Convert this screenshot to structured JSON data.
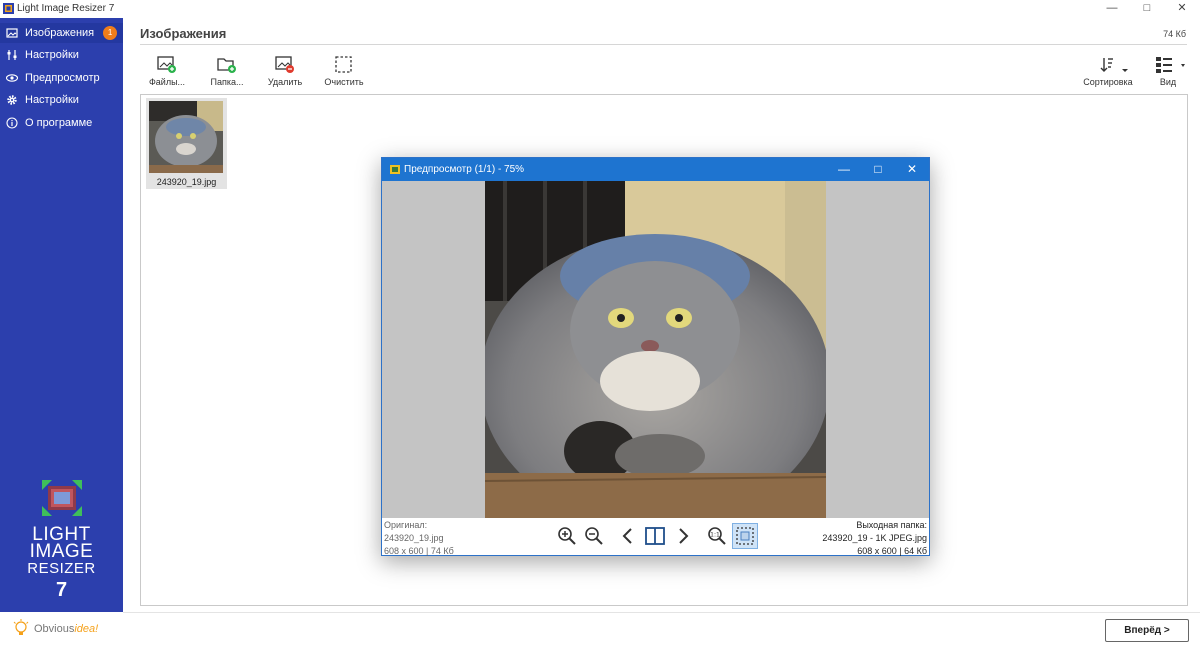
{
  "app": {
    "title": "Light Image Resizer 7"
  },
  "window_controls": {
    "minimize": "—",
    "maximize": "□",
    "close": "✕"
  },
  "sidebar": {
    "items": [
      {
        "label": "Изображения",
        "icon": "images-icon",
        "badge": "1",
        "active": true
      },
      {
        "label": "Настройки",
        "icon": "sliders-icon"
      },
      {
        "label": "Предпросмотр",
        "icon": "eye-icon"
      },
      {
        "label": "Настройки",
        "icon": "gear-icon"
      },
      {
        "label": "О программе",
        "icon": "info-icon"
      }
    ],
    "logo": {
      "line1": "LIGHT",
      "line2": "IMAGE",
      "line3": "RESIZER",
      "number": "7"
    },
    "brand": {
      "prefix": "Obvious",
      "suffix": "idea!"
    }
  },
  "header": {
    "title": "Изображения",
    "total_size": "74 Кб"
  },
  "toolbar": {
    "files_label": "Файлы...",
    "folder_label": "Папка...",
    "delete_label": "Удалить",
    "clear_label": "Очистить",
    "sort_label": "Сортировка",
    "view_label": "Вид"
  },
  "files": [
    {
      "name": "243920_19.jpg"
    }
  ],
  "preview": {
    "title": "Предпросмотр (1/1) - 75%",
    "original_label": "Оригинал:",
    "original_name": "243920_19.jpg",
    "original_info": "608 x 600  |  74 Кб",
    "output_label": "Выходная папка:",
    "output_name": "243920_19 - 1K JPEG.jpg",
    "output_info": "608 x 600  |  64 Кб"
  },
  "footer": {
    "next_label": "Вперёд >"
  },
  "colors": {
    "sidebar": "#2c3fad",
    "badge": "#f07d1a",
    "preview_titlebar": "#1e74d0",
    "accent_green": "#2bb24c",
    "accent_red": "#e03b2e"
  }
}
